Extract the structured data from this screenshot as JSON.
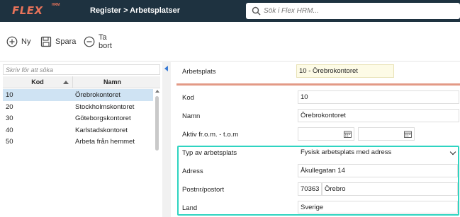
{
  "app": {
    "logo_text": "FLEX",
    "logo_sup": "HRM",
    "breadcrumb": "Register > Arbetsplatser",
    "search_placeholder": "Sök i Flex HRM..."
  },
  "toolbar": {
    "new_label": "Ny",
    "save_label": "Spara",
    "delete_label": "Ta bort"
  },
  "list": {
    "filter_placeholder": "Skriv för att söka",
    "columns": {
      "kod": "Kod",
      "namn": "Namn"
    },
    "rows": [
      {
        "kod": "10",
        "namn": "Örebrokontoret",
        "selected": true
      },
      {
        "kod": "20",
        "namn": "Stockholmskontoret"
      },
      {
        "kod": "30",
        "namn": "Göteborgskontoret"
      },
      {
        "kod": "40",
        "namn": "Karlstadskontoret"
      },
      {
        "kod": "50",
        "namn": "Arbeta från hemmet"
      }
    ]
  },
  "form": {
    "arbetsplats_label": "Arbetsplats",
    "arbetsplats_value": "10 - Örebrokontoret",
    "kod_label": "Kod",
    "kod_value": "10",
    "namn_label": "Namn",
    "namn_value": "Örebrokontoret",
    "aktiv_label": "Aktiv fr.o.m. - t.o.m",
    "typ_label": "Typ av arbetsplats",
    "typ_value": "Fysisk arbetsplats med adress",
    "adress_label": "Adress",
    "adress_value": "Åkullegatan 14",
    "postnr_label": "Postnr/postort",
    "postnr_value": "70363",
    "postort_value": "Örebro",
    "land_label": "Land",
    "land_value": "Sverige"
  },
  "colors": {
    "topbar": "#1e3240",
    "accent": "#e8735a",
    "selected_row": "#cfe3f3",
    "highlight": "#2fd4c1"
  }
}
